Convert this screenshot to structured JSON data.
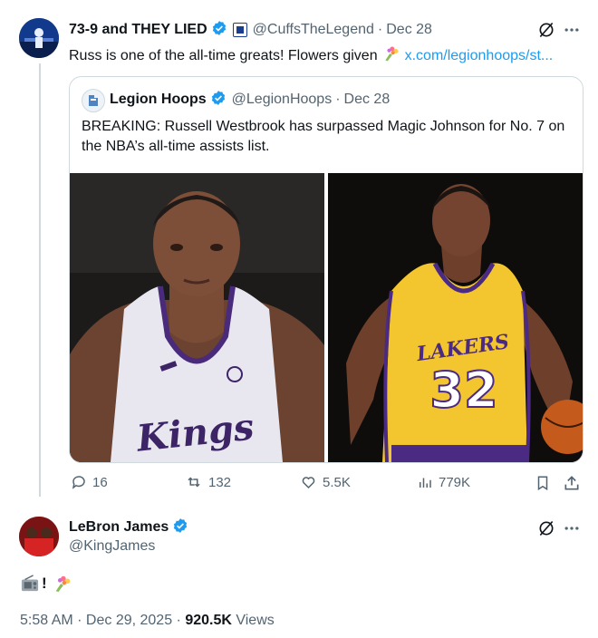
{
  "original_tweet": {
    "display_name": "73-9 and THEY LIED",
    "handle": "@CuffsTheLegend",
    "separator": "·",
    "date": "Dec 28",
    "text": "Russ is one of the all-time greats! Flowers given",
    "link": "x.com/legionhoops/st...",
    "quote": {
      "display_name": "Legion Hoops",
      "handle": "@LegionHoops",
      "separator": "·",
      "date": "Dec 28",
      "text": "BREAKING: Russell Westbrook has surpassed Magic Johnson for No. 7 on the NBA’s all-time assists list.",
      "left_jersey_text": "Kings",
      "right_jersey_text": "LAKERS",
      "right_jersey_number": "32"
    },
    "stats": {
      "replies": "16",
      "reposts": "132",
      "likes": "5.5K",
      "views": "779K"
    }
  },
  "reply_tweet": {
    "display_name": "LeBron James",
    "handle": "@KingJames",
    "text": "!",
    "timestamp": "5:58 AM · Dec 29, 2025 · ",
    "views_count": "920.5K",
    "views_label": " Views"
  },
  "colors": {
    "accent": "#1d9bf0",
    "text": "#0f1419",
    "muted": "#536471",
    "border": "#cfd9de",
    "lakers_gold": "#f3c62f",
    "lakers_purple": "#4b2a83",
    "kings_purple": "#5a2d82"
  },
  "icons": [
    "verified-badge-icon",
    "grok-icon",
    "more-icon",
    "reply-icon",
    "repost-icon",
    "like-icon",
    "views-icon",
    "bookmark-icon",
    "share-icon",
    "bouquet-icon",
    "radio-icon"
  ]
}
